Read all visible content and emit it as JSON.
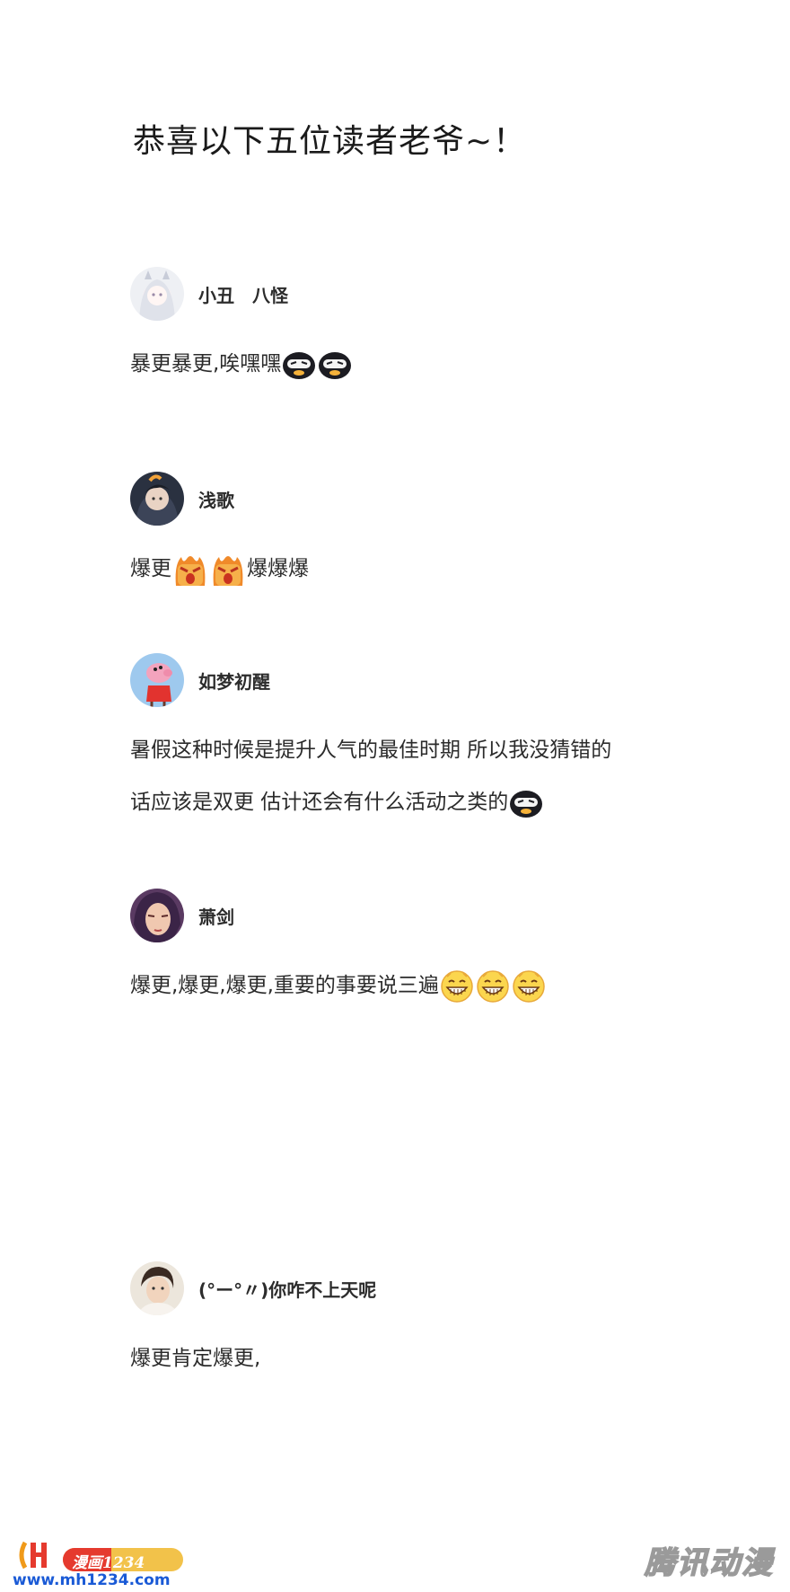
{
  "title": "恭喜以下五位读者老爷~！",
  "comments": [
    {
      "username": "小丑　八怪",
      "text": "暴更暴更,唉嘿嘿",
      "emojis": [
        "ninja-face-emoji",
        "ninja-face-emoji"
      ]
    },
    {
      "username": "浅歌",
      "text_before": "爆更",
      "text_after": "爆爆爆",
      "emojis": [
        "angry-fire-emoji",
        "angry-fire-emoji"
      ]
    },
    {
      "username": "如梦初醒",
      "text_line1": "暑假这种时候是提升人气的最佳时期 所以我没猜错的",
      "text_line2": "话应该是双更 估计还会有什么活动之类的",
      "emojis": [
        "ninja-face-emoji"
      ]
    },
    {
      "username": "萧剑",
      "text": "爆更,爆更,爆更,重要的事要说三遍",
      "emojis": [
        "grin-emoji",
        "grin-emoji",
        "grin-emoji"
      ]
    },
    {
      "username": "(°ー°〃)你咋不上天呢",
      "text": "爆更肯定爆更,"
    }
  ],
  "footer": {
    "badge_text": "漫画1234",
    "url": "www.mh1234.com",
    "watermark": "腾讯动漫"
  },
  "colors": {
    "url_blue": "#1a5ad6",
    "badge_yellow": "#f2c24a",
    "badge_red": "#e53a2e"
  }
}
